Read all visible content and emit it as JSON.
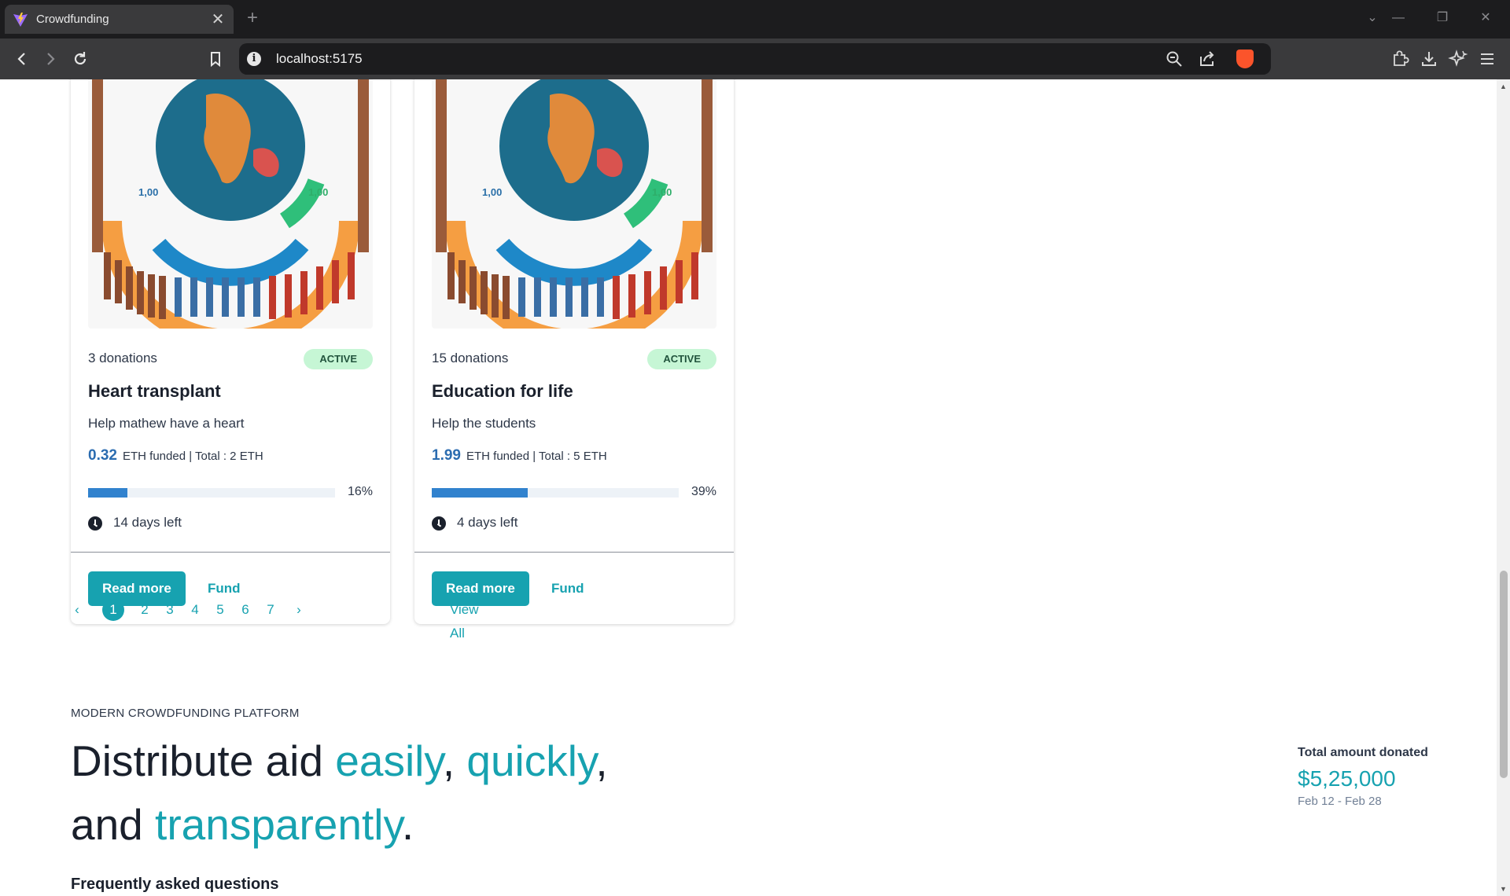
{
  "browser": {
    "tab_title": "Crowdfunding",
    "tab_close": "✕",
    "new_tab": "+",
    "url": "localhost:5175",
    "controls": {
      "tab_list": "⌄",
      "minimize": "—",
      "restore": "❐",
      "close": "✕"
    }
  },
  "icons": {
    "back": "arrow-left-icon",
    "forward": "arrow-right-icon",
    "reload": "reload-icon",
    "bookmark": "bookmark-icon",
    "info": "info-icon",
    "zoom": "zoom-out-icon",
    "share": "share-icon",
    "brave": "brave-shield-icon",
    "extensions": "puzzle-icon",
    "downloads": "download-icon",
    "leo": "sparkle-icon",
    "menu": "hamburger-menu-icon",
    "clock": "clock-icon"
  },
  "cards": [
    {
      "donations": "3 donations",
      "status": "ACTIVE",
      "title": "Heart transplant",
      "description": "Help mathew have a heart",
      "funded_amount": "0.32",
      "funded_text": "ETH funded | Total : 2 ETH",
      "progress": 0.16,
      "progress_label": "16%",
      "days_left": "14 days left",
      "read_more": "Read more",
      "fund": "Fund"
    },
    {
      "donations": "15 donations",
      "status": "ACTIVE",
      "title": "Education for life",
      "description": "Help the students",
      "funded_amount": "1.99",
      "funded_text": "ETH funded | Total : 5 ETH",
      "progress": 0.39,
      "progress_label": "39%",
      "days_left": "4 days left",
      "read_more": "Read more",
      "fund": "Fund"
    }
  ],
  "pagination": {
    "prev": "‹",
    "pages": [
      "1",
      "2",
      "3",
      "4",
      "5",
      "6",
      "7"
    ],
    "active": "1",
    "next": "›",
    "view_all": "View All"
  },
  "hero": {
    "eyebrow": "MODERN CROWDFUNDING PLATFORM",
    "line1_start": "Distribute aid ",
    "accent1": "easily",
    "comma1": ", ",
    "accent2": "quickly",
    "comma2": ",",
    "line2_start": "and ",
    "accent3": "transparently",
    "period": "."
  },
  "stats": {
    "label": "Total amount donated",
    "value": "$5,25,000",
    "range": "Feb 12 - Feb 28"
  },
  "faq_heading": "Frequently asked questions",
  "colors": {
    "accent": "#17a2b0",
    "funded_blue": "#2b6cb0",
    "progress_blue": "#3182ce",
    "badge_bg": "#c6f6d5",
    "badge_text": "#22543d"
  }
}
